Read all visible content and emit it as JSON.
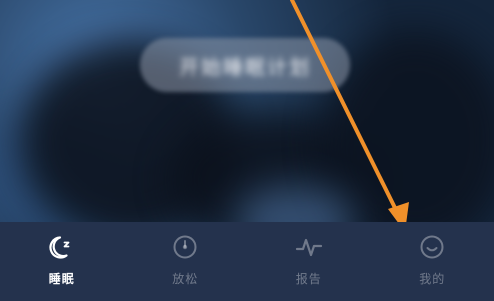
{
  "overlay": {
    "blurred_button_label": "开始睡眠计划"
  },
  "tabs": [
    {
      "label": "睡眠",
      "icon": "moon-icon",
      "active": true
    },
    {
      "label": "放松",
      "icon": "timer-icon",
      "active": false
    },
    {
      "label": "报告",
      "icon": "pulse-icon",
      "active": false
    },
    {
      "label": "我的",
      "icon": "smile-icon",
      "active": false
    }
  ],
  "colors": {
    "tabbar_bg": "#24324d",
    "active": "#ffffff",
    "inactive": "rgba(255,255,255,0.35)",
    "annotation_arrow": "#f0902a"
  }
}
